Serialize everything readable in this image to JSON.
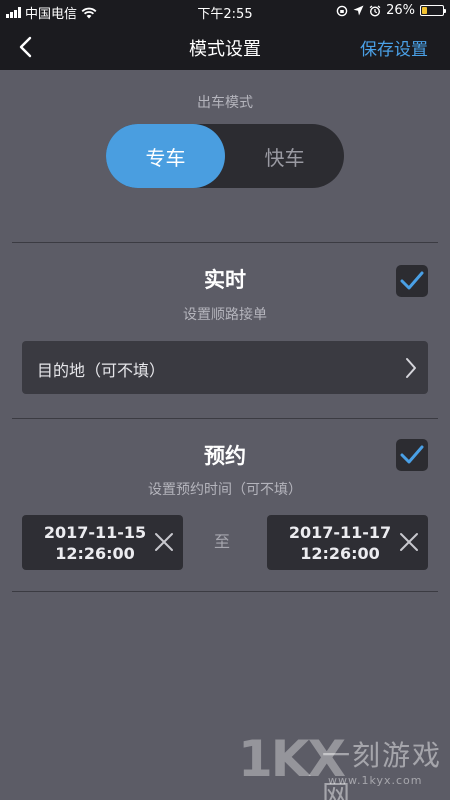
{
  "status_bar": {
    "carrier": "中国电信",
    "time": "下午2:55",
    "battery": "26%",
    "battery_level": 0.26
  },
  "nav": {
    "title": "模式设置",
    "save_label": "保存设置"
  },
  "mode": {
    "label": "出车模式",
    "options": [
      "专车",
      "快车"
    ],
    "selected": "专车"
  },
  "realtime": {
    "title": "实时",
    "subtitle": "设置顺路接单",
    "checked": true,
    "destination_placeholder": "目的地（可不填）"
  },
  "reservation": {
    "title": "预约",
    "subtitle": "设置预约时间（可不填）",
    "checked": true,
    "start": {
      "date": "2017-11-15",
      "time": "12:26:00"
    },
    "separator": "至",
    "end": {
      "date": "2017-11-17",
      "time": "12:26:00"
    }
  },
  "watermark": {
    "logo": "1KX",
    "name": "一刻游戏网",
    "url": "www.1kyx.com"
  },
  "colors": {
    "accent": "#4a9ee0",
    "background": "#5c5c66",
    "header": "#1b1b1f",
    "check": "#4aa0e6"
  }
}
